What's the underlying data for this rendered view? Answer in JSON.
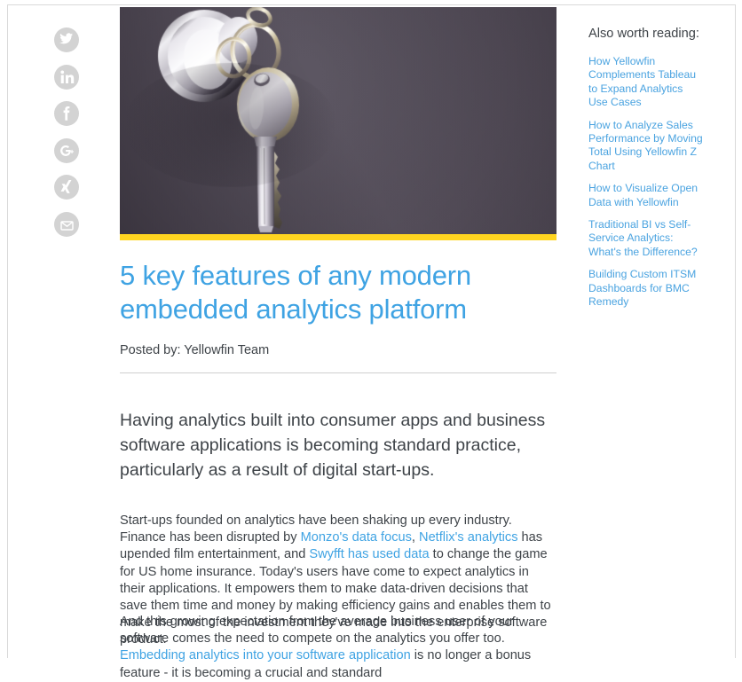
{
  "theme": {
    "accent_blue": "#3fa3e3",
    "link_blue": "#4aa3e0",
    "accent_yellow": "#ffd520",
    "text_dark": "#3e4348",
    "icon_grey": "#d3d3d3",
    "rule_grey": "#cfcfcf"
  },
  "share": {
    "items": [
      {
        "name": "twitter-share-button",
        "icon": "twitter-icon",
        "label": "Twitter"
      },
      {
        "name": "linkedin-share-button",
        "icon": "linkedin-icon",
        "label": "LinkedIn"
      },
      {
        "name": "facebook-share-button",
        "icon": "facebook-icon",
        "label": "Facebook"
      },
      {
        "name": "googleplus-share-button",
        "icon": "google-plus-icon",
        "label": "Google Plus"
      },
      {
        "name": "xing-share-button",
        "icon": "xing-icon",
        "label": "Xing"
      },
      {
        "name": "email-share-button",
        "icon": "envelope-icon",
        "label": "Email"
      }
    ]
  },
  "hero": {
    "alt": "Silver key on a keyring hanging in a door lock against a dark grey-purple wall",
    "accent_bar_color": "#ffd520"
  },
  "article": {
    "title": "5 key features of any modern embedded analytics platform",
    "byline": "Posted by: Yellowfin Team",
    "lede": "Having analytics built into consumer apps and business software applications is becoming standard practice, particularly as a result of digital start-ups.",
    "paragraph_1": {
      "segments": [
        {
          "type": "text",
          "text": "Start-ups founded on analytics have been shaking up every industry. Finance has been disrupted by "
        },
        {
          "type": "link",
          "text": "Monzo's data focus"
        },
        {
          "type": "text",
          "text": ", "
        },
        {
          "type": "link",
          "text": "Netflix's analytics"
        },
        {
          "type": "text",
          "text": " has upended film entertainment, and "
        },
        {
          "type": "link",
          "text": "Swyfft has used data"
        },
        {
          "type": "text",
          "text": " to change the game for US home insurance. Today's users have come to expect analytics in their applications. It empowers them to make data-driven decisions that save them time and money by making efficiency gains and enables them to make the most of the investment they've made into the enterprise software product."
        }
      ]
    },
    "paragraph_2": {
      "segments": [
        {
          "type": "text",
          "text": "And this growing expectation from the average business user of your software comes the need to compete on the analytics you offer too. "
        },
        {
          "type": "link",
          "text": "Embedding analytics into your software application"
        },
        {
          "type": "text",
          "text": " is no longer a bonus feature - it is becoming a crucial and standard"
        }
      ]
    }
  },
  "sidebar": {
    "heading": "Also worth reading:",
    "links": [
      "How Yellowfin Complements Tableau to Expand Analytics Use Cases",
      "How to Analyze Sales Performance by Moving Total Using Yellowfin Z Chart",
      "How to Visualize Open Data with Yellowfin",
      "Traditional BI vs Self-Service Analytics: What's the Difference?",
      "Building Custom ITSM Dashboards for BMC Remedy"
    ]
  }
}
